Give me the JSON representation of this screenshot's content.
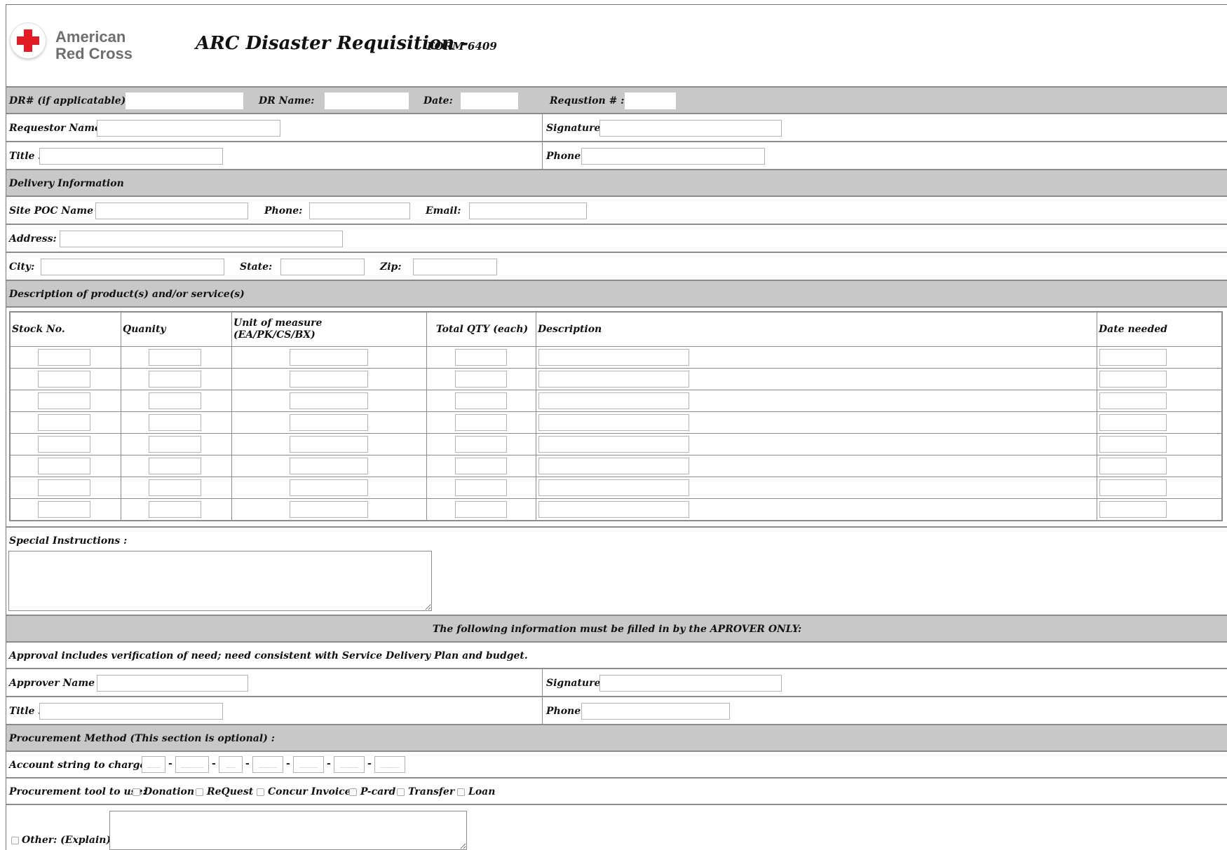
{
  "header": {
    "logo_line1": "American",
    "logo_line2": "Red Cross",
    "title": "ARC Disaster Requisition -",
    "form_number": "FORM 6409"
  },
  "top_row": {
    "dr_number": "DR# (if applicatable):",
    "dr_name": "DR Name:",
    "date": "Date:",
    "requisition_no": "Requstion # :"
  },
  "requestor": {
    "name": "Requestor Name :",
    "signature": "Signature:",
    "title": "Title :",
    "phone": "Phone:"
  },
  "delivery": {
    "section": "Delivery Information",
    "poc_name": "Site POC Name :",
    "phone": "Phone:",
    "email": "Email:",
    "address": "Address:",
    "city": "City:",
    "state": "State:",
    "zip": "Zip:"
  },
  "products": {
    "section": "Description of product(s) and/or service(s)",
    "columns": [
      "Stock No.",
      "Quanity",
      "Unit of measure\n(EA/PK/CS/BX)",
      "Total QTY (each)",
      "Description",
      "Date needed"
    ],
    "row_count": 8
  },
  "special": {
    "label": "Special Instructions :"
  },
  "approver": {
    "section": "The following information must be filled in by the APROVER ONLY:",
    "note": "Approval includes verification of need; need consistent with Service Delivery Plan and budget.",
    "name": "Approver Name :",
    "signature": "Signature:",
    "title": "Title :",
    "phone": "Phone:"
  },
  "procurement": {
    "section": "Procurement Method (This section is optional) :",
    "account_label": "Account string to charge:",
    "account_segments": [
      "___",
      "_____",
      "__",
      "____",
      "____",
      "____",
      "____"
    ],
    "tool_label": "Procurement tool to use:",
    "tools": [
      "Donation",
      "ReQuest",
      "Concur Invoice",
      "P-card",
      "Transfer",
      "Loan"
    ],
    "other_label": "Other: (Explain) :"
  },
  "colors": {
    "section_gray": "#c8c8c8",
    "border": "#8c8c8c",
    "red_cross": "#e31b23",
    "logo_text": "#6d6e71"
  }
}
